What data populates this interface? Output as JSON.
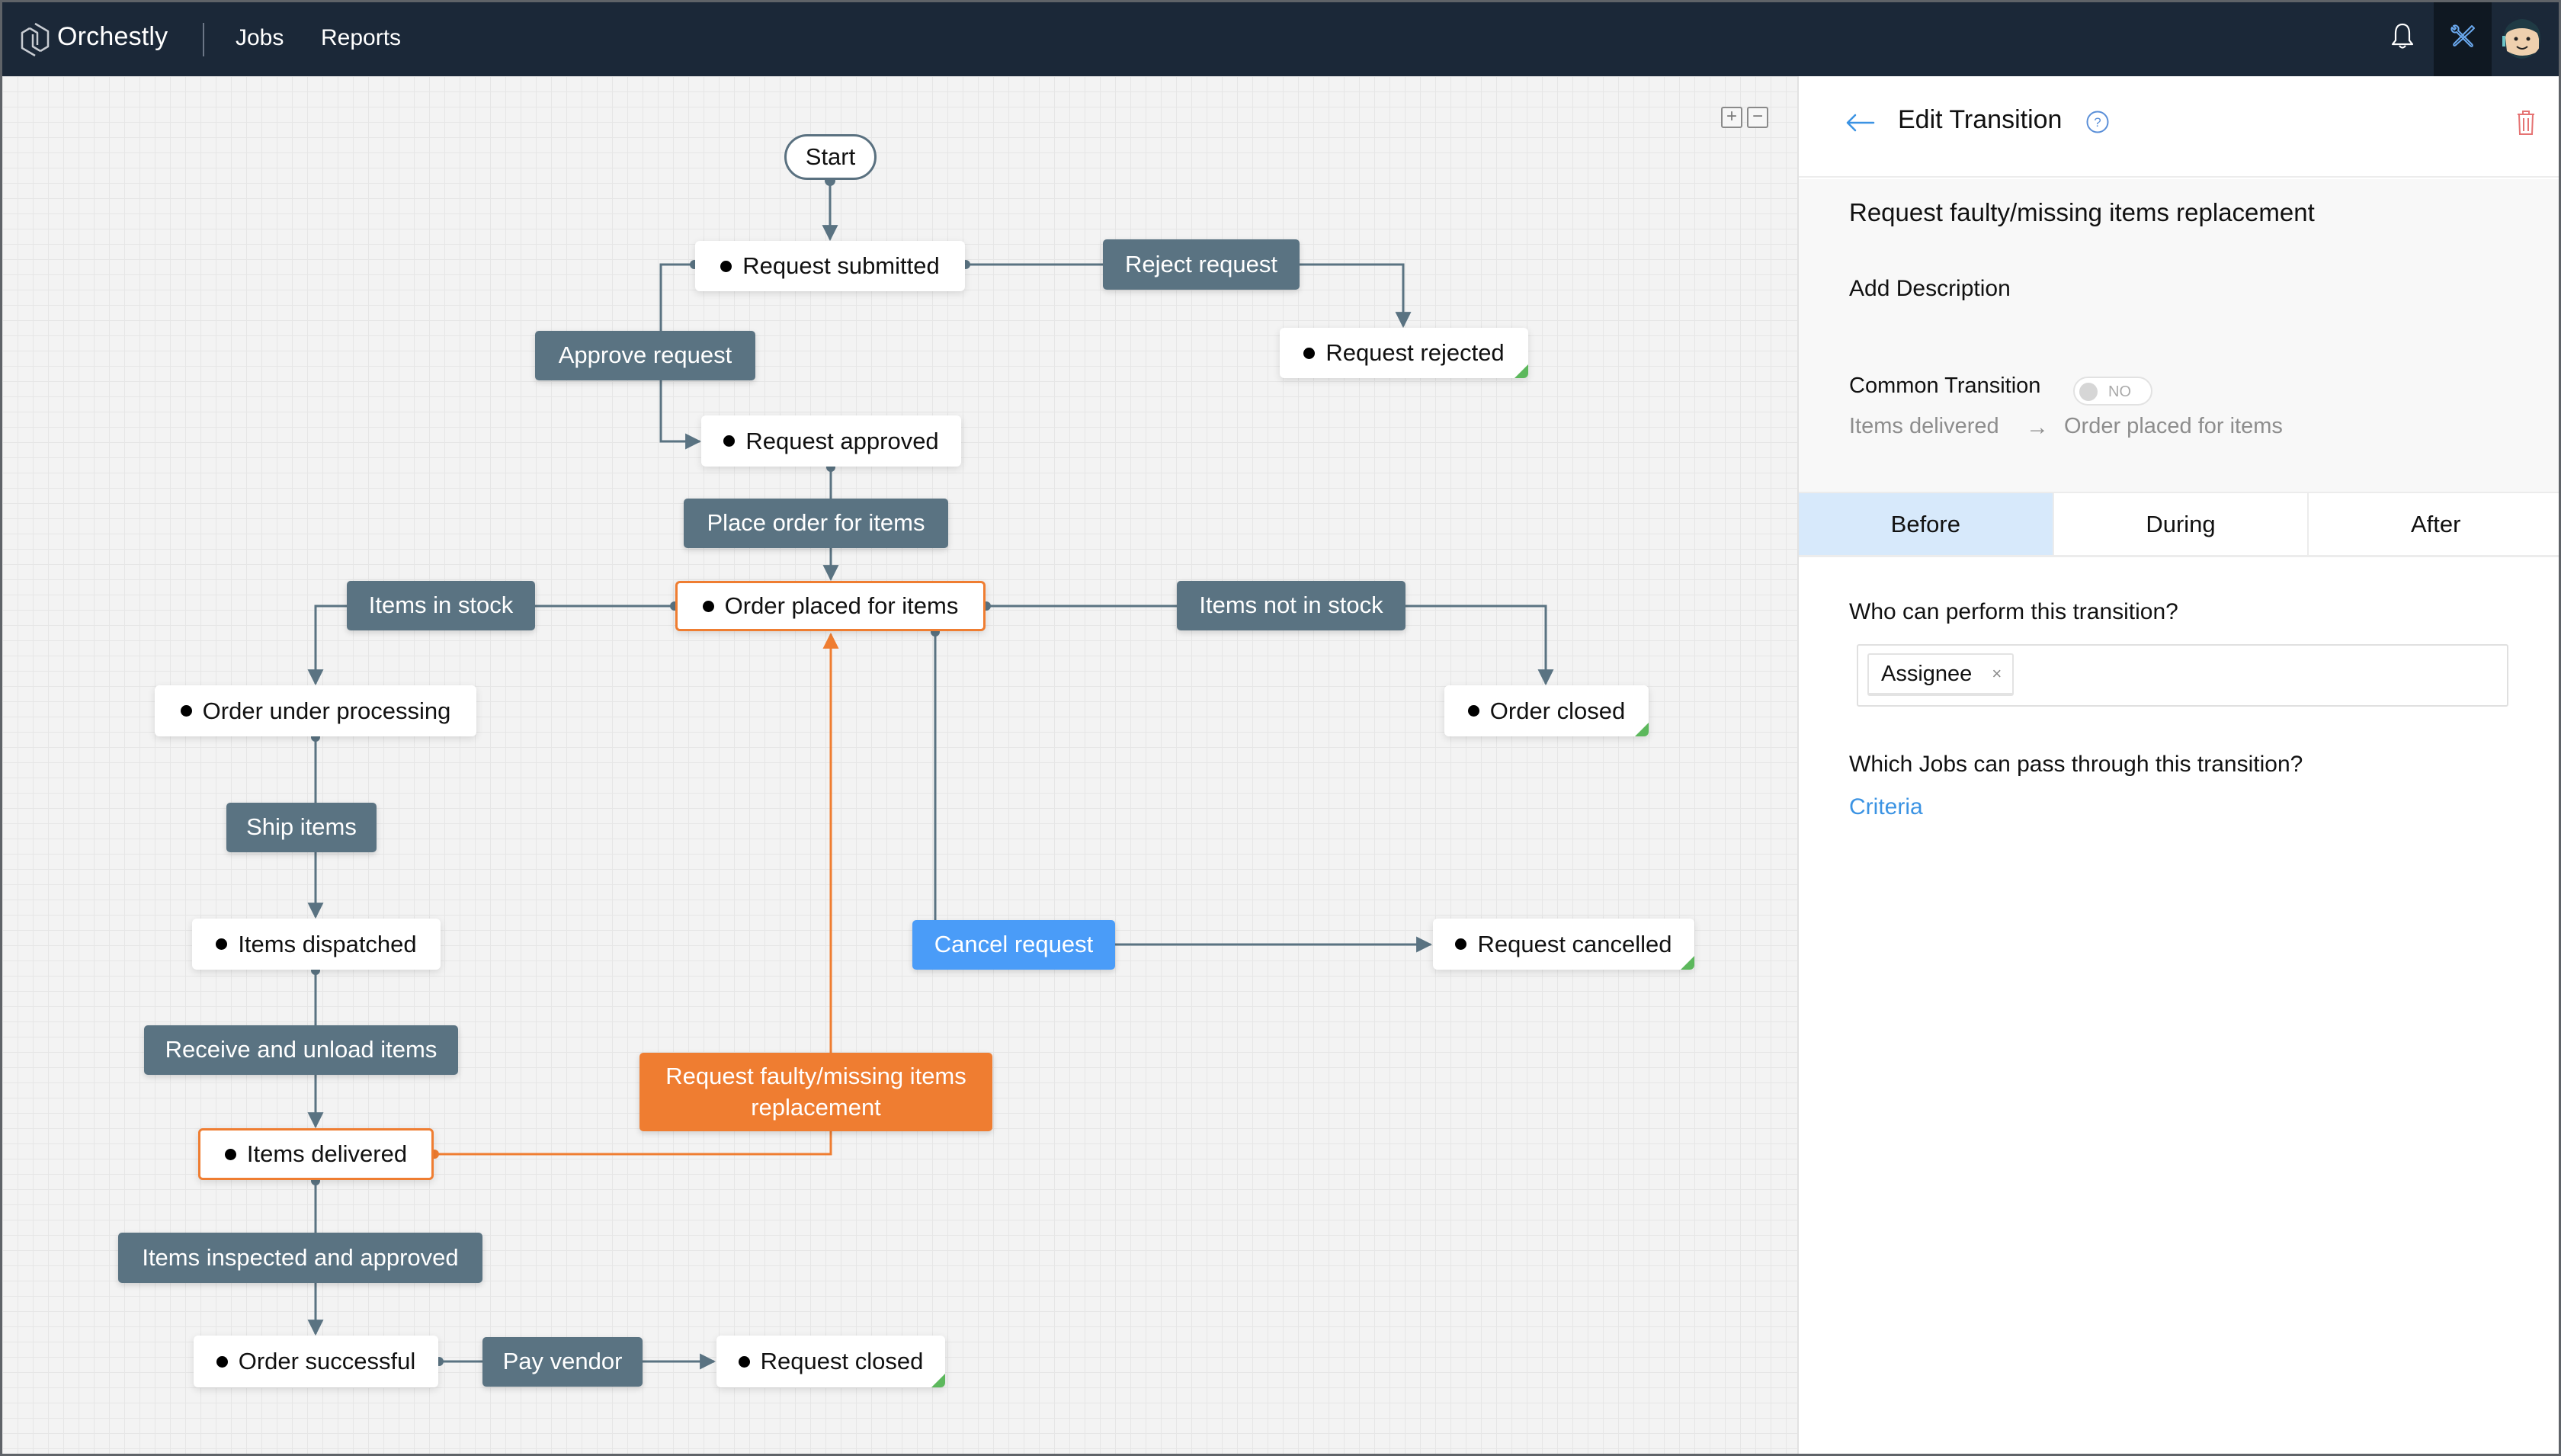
{
  "header": {
    "brand": "Orchestly",
    "nav": [
      {
        "label": "Jobs"
      },
      {
        "label": "Reports"
      }
    ],
    "icons": [
      "notification-bell-icon",
      "tools-icon",
      "user-avatar"
    ]
  },
  "canvas": {
    "zoom_in": "+",
    "zoom_out": "−",
    "start": "Start",
    "states": {
      "request_submitted": "Request submitted",
      "request_rejected": "Request rejected",
      "request_approved": "Request approved",
      "order_placed": "Order placed for items",
      "order_under_processing": "Order under processing",
      "order_closed": "Order closed",
      "items_dispatched": "Items dispatched",
      "request_cancelled": "Request cancelled",
      "items_delivered": "Items delivered",
      "order_successful": "Order successful",
      "request_closed": "Request closed"
    },
    "transitions": {
      "reject_request": "Reject request",
      "approve_request": "Approve request",
      "place_order": "Place order for items",
      "items_in_stock": "Items in stock",
      "items_not_in_stock": "Items not in stock",
      "ship_items": "Ship items",
      "cancel_request": "Cancel request",
      "receive_unload": "Receive and unload items",
      "request_replacement": "Request faulty/missing items replacement",
      "items_inspected": "Items inspected and approved",
      "pay_vendor": "Pay vendor"
    },
    "colors": {
      "transition": "#5a7382",
      "selected_transition": "#ef7d31",
      "highlight_transition": "#4a9cf8",
      "end_state_marker": "#5cb85c",
      "edge": "#5a7382"
    }
  },
  "panel": {
    "title": "Edit Transition",
    "transition_name": "Request faulty/missing items replacement",
    "add_description": "Add Description",
    "common_transition_label": "Common Transition",
    "common_transition_toggle": "NO",
    "from_state": "Items delivered",
    "arrow": "→",
    "to_state": "Order placed for items",
    "tabs": [
      {
        "label": "Before",
        "active": true
      },
      {
        "label": "During",
        "active": false
      },
      {
        "label": "After",
        "active": false
      }
    ],
    "who_question": "Who can perform this transition?",
    "performers": [
      {
        "label": "Assignee",
        "remove": "×"
      }
    ],
    "jobs_question": "Which Jobs can pass through this transition?",
    "criteria_link": "Criteria"
  }
}
